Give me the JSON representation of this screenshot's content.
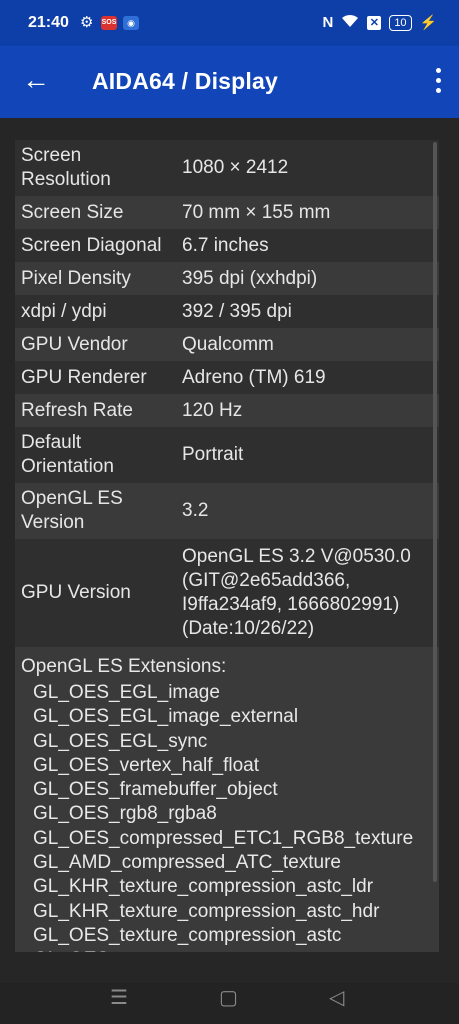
{
  "statusbar": {
    "time": "21:40",
    "gear_icon": "gear-icon",
    "sos_label": "SOS",
    "nfc_label": "N",
    "battery": "10"
  },
  "appbar": {
    "title": "AIDA64  /  Display"
  },
  "rows": [
    {
      "key": "Screen\nResolution",
      "value": "1080 × 2412"
    },
    {
      "key": "Screen Size",
      "value": "70 mm × 155 mm"
    },
    {
      "key": "Screen Diagonal",
      "value": "6.7 inches"
    },
    {
      "key": "Pixel Density",
      "value": "395 dpi (xxhdpi)"
    },
    {
      "key": "xdpi / ydpi",
      "value": "392 / 395 dpi"
    },
    {
      "key": "GPU Vendor",
      "value": "Qualcomm"
    },
    {
      "key": "GPU Renderer",
      "value": "Adreno (TM) 619"
    },
    {
      "key": "Refresh Rate",
      "value": "120 Hz"
    },
    {
      "key": "Default\nOrientation",
      "value": "Portrait"
    },
    {
      "key": "OpenGL ES\nVersion",
      "value": "3.2"
    },
    {
      "key": "GPU Version",
      "value": "OpenGL ES 3.2 V@0530.0\n(GIT@2e65add366,\nI9ffa234af9, 1666802991)\n(Date:10/26/22)"
    }
  ],
  "extensions": {
    "title": "OpenGL ES Extensions:",
    "items": [
      "GL_OES_EGL_image",
      "GL_OES_EGL_image_external",
      "GL_OES_EGL_sync",
      "GL_OES_vertex_half_float",
      "GL_OES_framebuffer_object",
      "GL_OES_rgb8_rgba8",
      "GL_OES_compressed_ETC1_RGB8_texture",
      "GL_AMD_compressed_ATC_texture",
      "GL_KHR_texture_compression_astc_ldr",
      "GL_KHR_texture_compression_astc_hdr",
      "GL_OES_texture_compression_astc",
      "GL_OES_texture_npot"
    ]
  },
  "navbar": {
    "menu_glyph": "☰",
    "home_glyph": "▢",
    "back_glyph": "◁"
  }
}
